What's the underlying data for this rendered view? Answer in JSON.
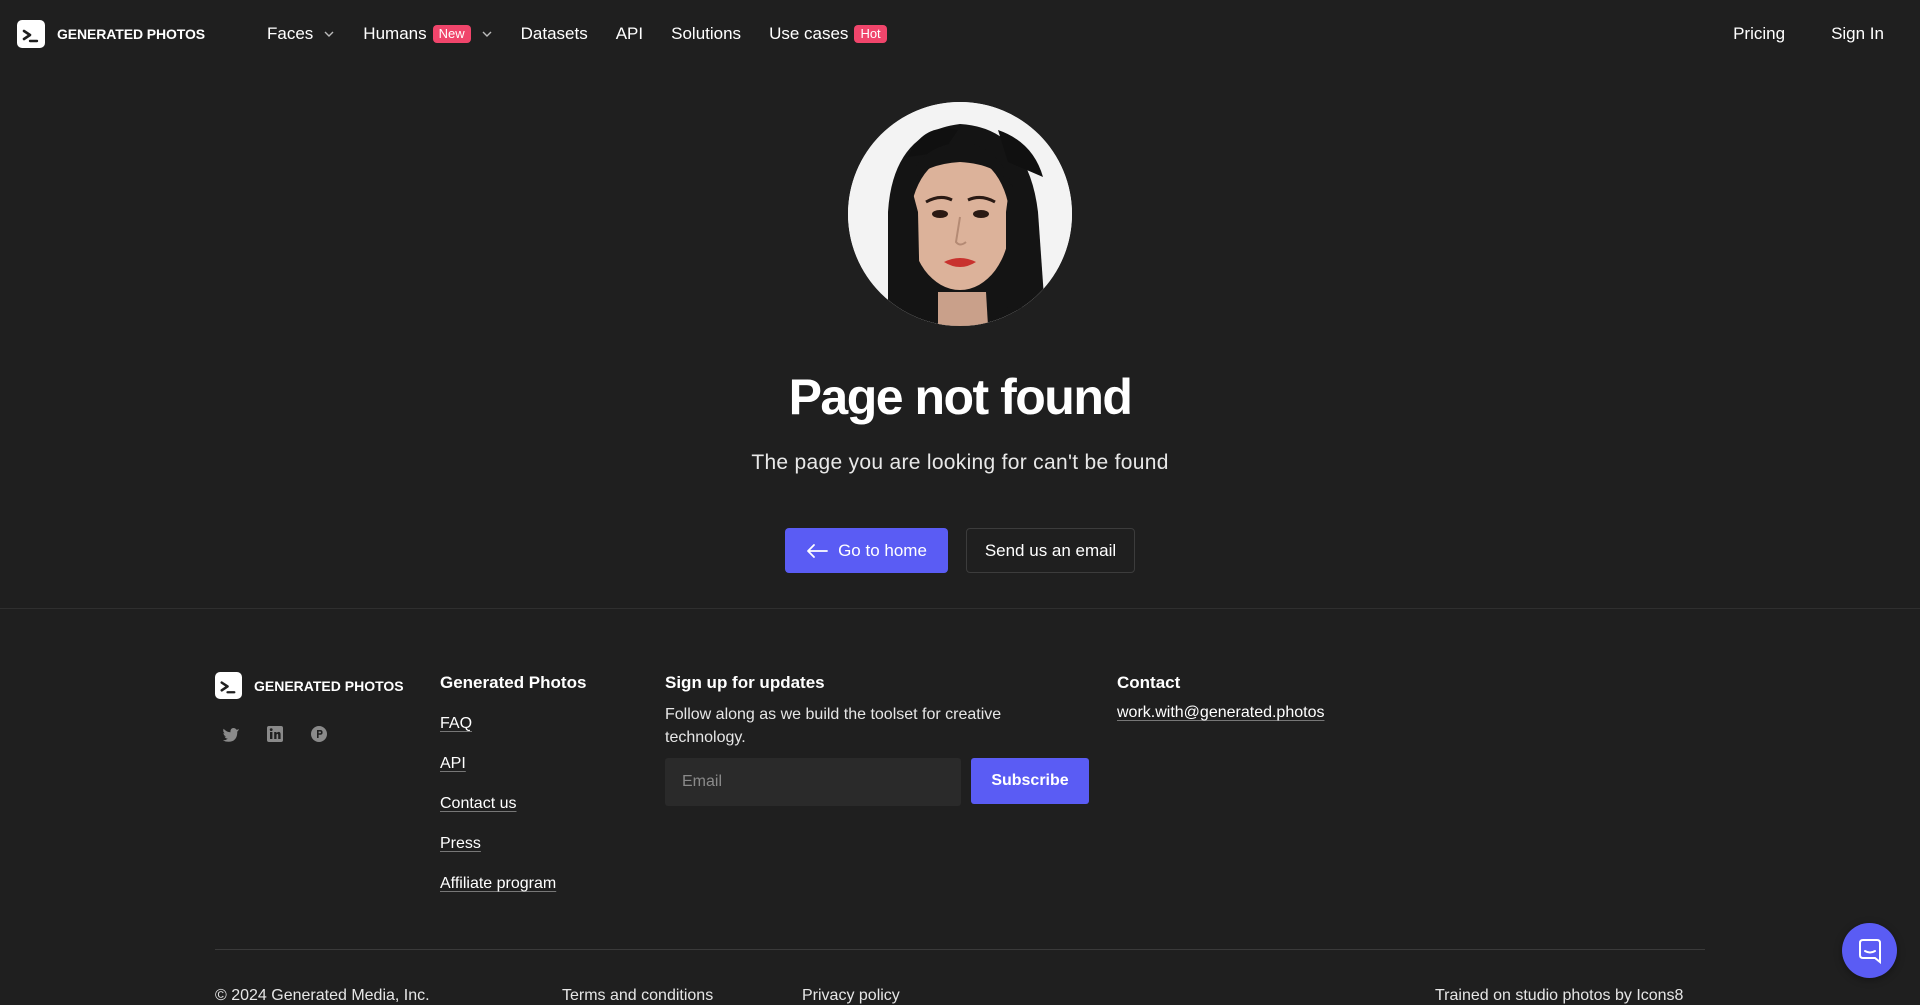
{
  "brand": {
    "name": "GENERATED PHOTOS"
  },
  "nav": {
    "items": [
      {
        "label": "Faces",
        "has_dropdown": true
      },
      {
        "label": "Humans",
        "badge": "New",
        "has_dropdown": true
      },
      {
        "label": "Datasets"
      },
      {
        "label": "API"
      },
      {
        "label": "Solutions"
      },
      {
        "label": "Use cases",
        "badge": "Hot"
      }
    ],
    "pricing": "Pricing",
    "sign_in": "Sign In"
  },
  "main": {
    "title": "Page not found",
    "subtitle": "The page you are looking for can't be found",
    "primary_button": "Go to home",
    "secondary_button": "Send us an email"
  },
  "footer": {
    "brand": "GENERATED PHOTOS",
    "socials": [
      "twitter-icon",
      "linkedin-icon",
      "producthunt-icon"
    ],
    "col1": {
      "title": "Generated Photos",
      "links": [
        "FAQ",
        "API",
        "Contact us",
        "Press",
        "Affiliate program"
      ]
    },
    "signup": {
      "title": "Sign up for updates",
      "description": "Follow along as we build the toolset for creative technology.",
      "email_placeholder": "Email",
      "button": "Subscribe"
    },
    "contact": {
      "title": "Contact",
      "email": "work.with@generated.photos"
    },
    "bottom": {
      "copyright": "© 2024 Generated Media, Inc.",
      "terms": "Terms and conditions",
      "privacy": "Privacy policy",
      "trained": "Trained on studio photos by Icons8"
    }
  },
  "colors": {
    "background": "#1f1f1f",
    "accent": "#5a5cf4",
    "badge": "#f0456b"
  }
}
